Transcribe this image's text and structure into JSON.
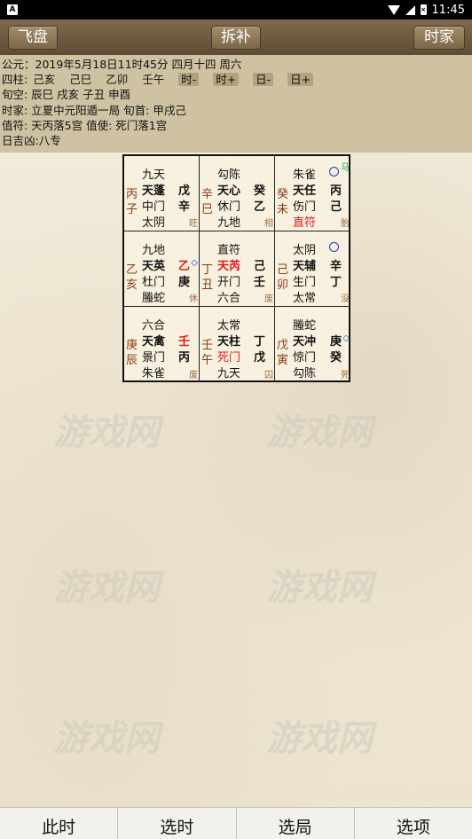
{
  "status": {
    "time": "11:45",
    "left_icon": "A",
    "battery_label": "×"
  },
  "toolbar": {
    "fly_label": "飞盘",
    "split_label": "拆补",
    "timehome_label": "时家"
  },
  "info": {
    "line1": "公元：2019年5月18日11时45分 四月十四 周六",
    "pillars_label": "四柱:",
    "pillars": [
      "己亥",
      "己巳",
      "乙卯",
      "壬午"
    ],
    "pills": [
      "时-",
      "时+",
      "日-",
      "日+"
    ],
    "line3": "旬空: 辰巳   戌亥   子丑   申酉",
    "line4": "时家: 立夏中元阳遁一局   旬首: 甲戌己",
    "line5": "值符: 天丙落5宫   值使: 死门落1宫",
    "line6": "日吉凶:八专"
  },
  "palaces": [
    {
      "gan1": "丙",
      "gan2": "子",
      "god": "九天",
      "star": "天蓬",
      "tianpan": "戊",
      "door": "中门",
      "dipan": "辛",
      "god2": "太阴",
      "state": "旺"
    },
    {
      "gan1": "辛",
      "gan2": "巳",
      "god": "勾陈",
      "star": "天心",
      "tianpan": "癸",
      "door": "休门",
      "dipan": "乙",
      "god2": "九地",
      "state": "相"
    },
    {
      "gan1": "癸",
      "gan2": "未",
      "god": "朱雀",
      "star": "天任",
      "tianpan": "丙",
      "door": "伤门",
      "dipan": "己",
      "god2": "直符",
      "state": "胎",
      "horse": "马"
    },
    {
      "gan1": "乙",
      "gan2": "亥",
      "god": "九地",
      "star": "天英",
      "tianpan": "乙",
      "door": "杜门",
      "dipan": "庚",
      "god2": "螣蛇",
      "state": "休"
    },
    {
      "gan1": "丁",
      "gan2": "丑",
      "god": "直符",
      "star": "天芮",
      "tianpan": "己",
      "door": "开门",
      "dipan": "壬",
      "god2": "六合",
      "state": "废"
    },
    {
      "gan1": "己",
      "gan2": "卯",
      "god": "太阴",
      "star": "天辅",
      "tianpan": "辛",
      "door": "生门",
      "dipan": "丁",
      "god2": "太常",
      "state": "没"
    },
    {
      "gan1": "庚",
      "gan2": "辰",
      "god": "六合",
      "star": "天禽",
      "tianpan": "壬",
      "door": "景门",
      "dipan": "丙",
      "god2": "朱雀",
      "state": "废"
    },
    {
      "gan1": "壬",
      "gan2": "午",
      "god": "太常",
      "star": "天柱",
      "tianpan": "丁",
      "door": "死门",
      "dipan": "戊",
      "god2": "九天",
      "state": "囚"
    },
    {
      "gan1": "戊",
      "gan2": "寅",
      "god": "螣蛇",
      "star": "天冲",
      "tianpan": "庚",
      "door": "惊门",
      "dipan": "癸",
      "god2": "勾陈",
      "state": "死"
    }
  ],
  "watermark": "游戏网",
  "bottom": {
    "now_label": "此时",
    "pick_time_label": "选时",
    "pick_ju_label": "选局",
    "options_label": "选项"
  },
  "colors": {
    "toolbar": "#6f5d42",
    "info_bg": "#cfc2a3",
    "red": "#e01919",
    "blue_circle": "#2233cc",
    "horse": "#1aa34a"
  }
}
